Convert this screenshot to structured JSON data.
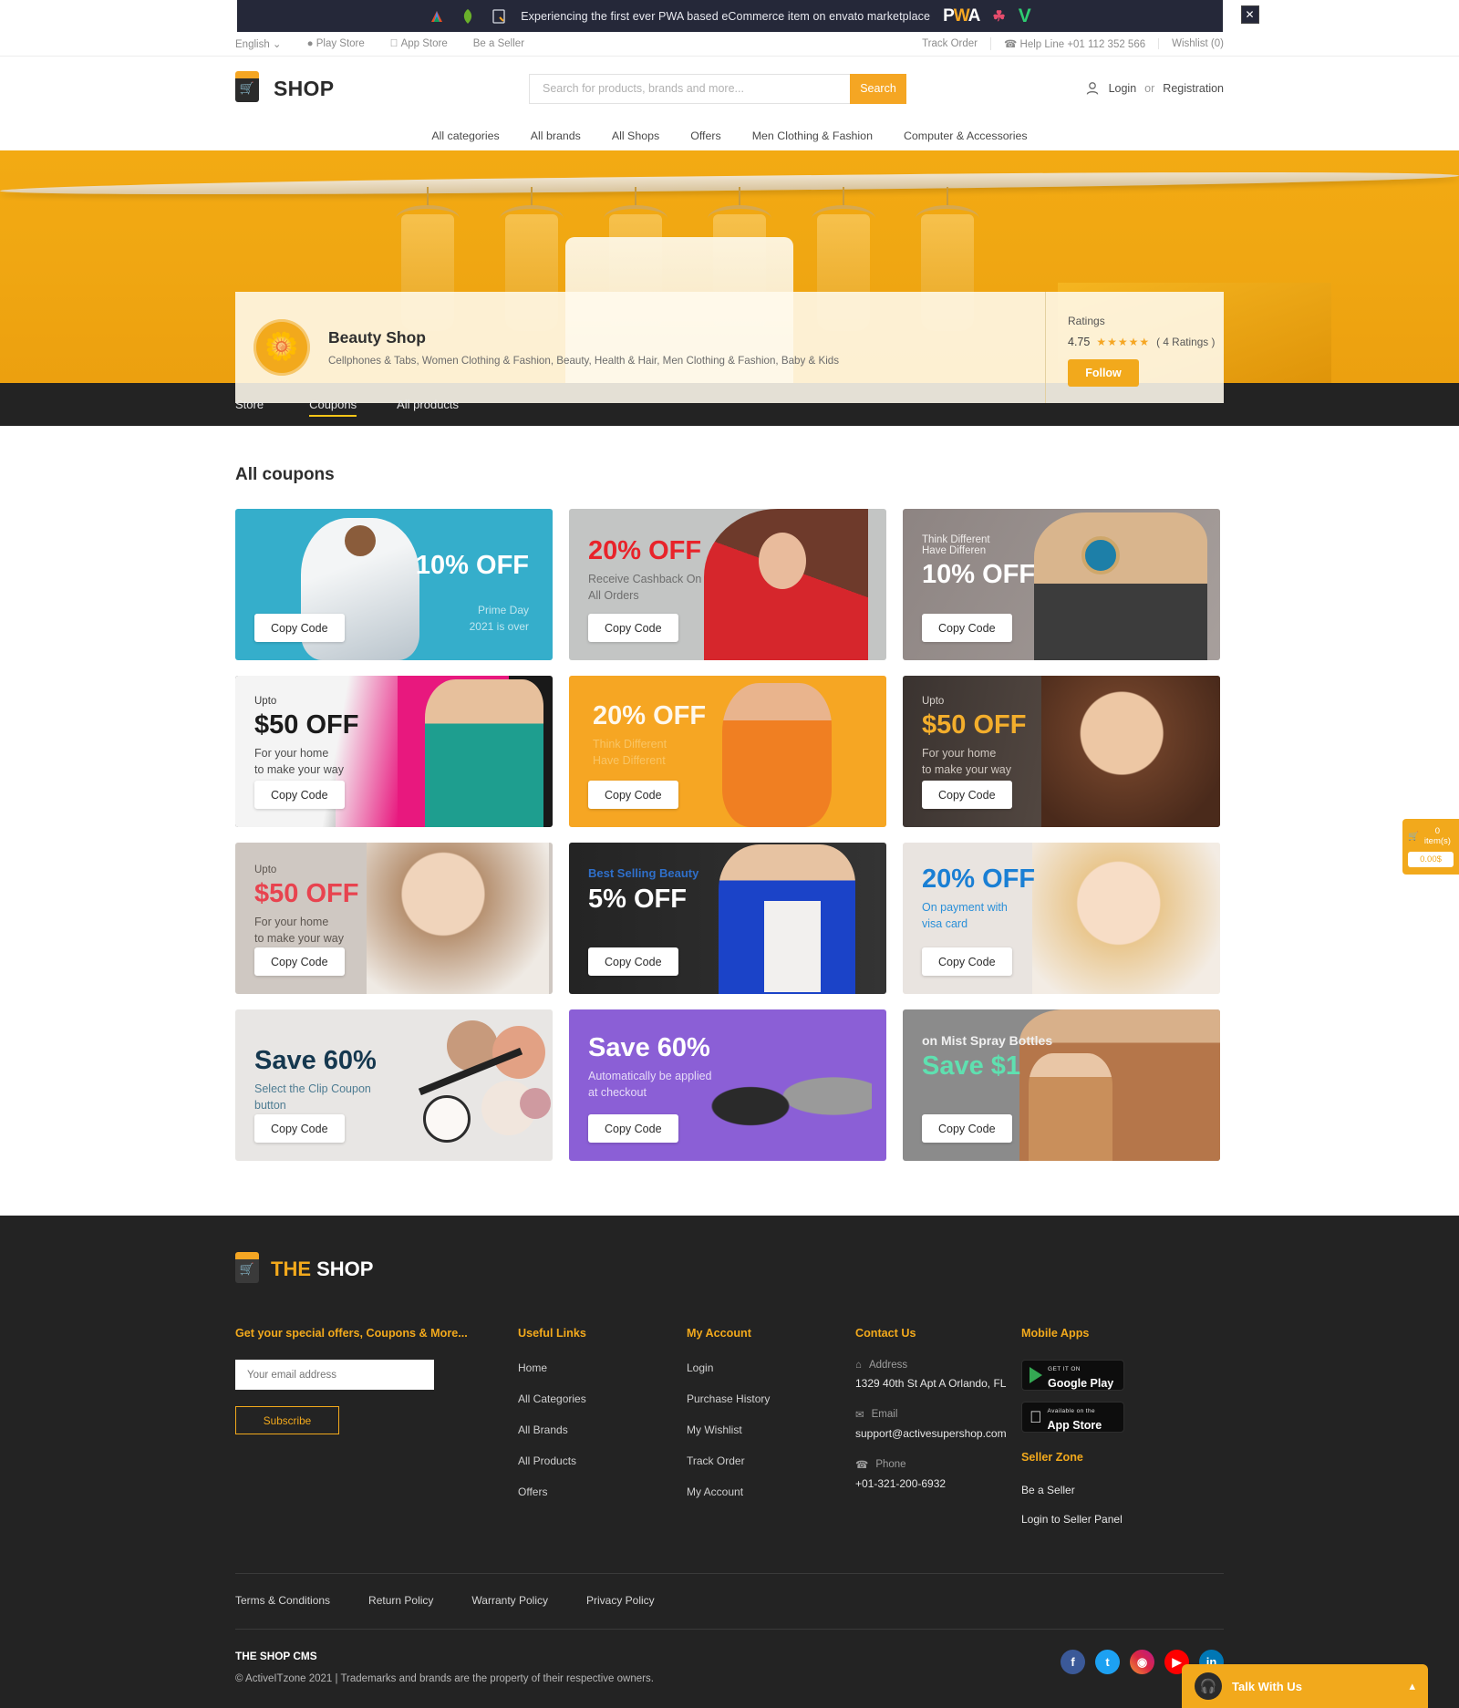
{
  "promo": {
    "text": "Experiencing the first ever PWA based eCommerce item on envato marketplace",
    "pwa_label": "PWA",
    "close_icon": "close-icon"
  },
  "topbar": {
    "language": "English",
    "play_store": "Play Store",
    "app_store": "App Store",
    "be_a_seller": "Be a Seller",
    "track_order": "Track Order",
    "help_line": "Help Line +01 112 352 566",
    "wishlist": "Wishlist (0)"
  },
  "header": {
    "brand": "SHOP",
    "search_placeholder": "Search for products, brands and more...",
    "search_value": "",
    "search_button": "Search",
    "login": "Login",
    "or": "or",
    "registration": "Registration"
  },
  "nav": {
    "items": [
      {
        "label": "All categories"
      },
      {
        "label": "All brands"
      },
      {
        "label": "All Shops"
      },
      {
        "label": "Offers"
      },
      {
        "label": "Men Clothing & Fashion"
      },
      {
        "label": "Computer & Accessories"
      }
    ]
  },
  "shop": {
    "name": "Beauty Shop",
    "categories": "Cellphones & Tabs, Women Clothing & Fashion, Beauty, Health & Hair, Men Clothing & Fashion, Baby & Kids",
    "ratings_label": "Ratings",
    "rating_value": "4.75",
    "stars": "★★★★",
    "half_star": "★",
    "ratings_count": "( 4 Ratings )",
    "follow_button": "Follow"
  },
  "tabs": [
    {
      "label": "Store",
      "active": false
    },
    {
      "label": "Coupons",
      "active": true
    },
    {
      "label": "All products",
      "active": false
    }
  ],
  "coupons_section": {
    "title": "All coupons",
    "copy_label": "Copy Code"
  },
  "coupons": [
    {
      "top": "",
      "big": "10% OFF",
      "small": "",
      "footnote": "Prime Day\n2021 is over"
    },
    {
      "top": "",
      "big": "20% OFF",
      "small": "Receive Cashback On\nAll Orders",
      "footnote": ""
    },
    {
      "top": "Think Different\nHave Differen",
      "big": "10% OFF",
      "small": "",
      "footnote": ""
    },
    {
      "top": "Upto",
      "big": "$50 OFF",
      "small": "For your home\nto make your way",
      "footnote": ""
    },
    {
      "top": "",
      "big": "20% OFF",
      "small": "Think Different\nHave Different",
      "footnote": ""
    },
    {
      "top": "Upto",
      "big": "$50 OFF",
      "small": "For your home\nto make your way",
      "footnote": ""
    },
    {
      "top": "Upto",
      "big": "$50 OFF",
      "small": "For your home\nto make your way",
      "footnote": ""
    },
    {
      "top": "Best Selling Beauty",
      "big": "5% OFF",
      "small": "",
      "footnote": ""
    },
    {
      "top": "",
      "big": "20% OFF",
      "small": "On payment with\nvisa card",
      "footnote": ""
    },
    {
      "top": "",
      "big": "Save 60%",
      "small": "Select the Clip Coupon\nbutton",
      "footnote": ""
    },
    {
      "top": "",
      "big": "Save 60%",
      "small": "Automatically be applied\nat checkout",
      "footnote": ""
    },
    {
      "top": "on Mist Spray Bottles",
      "big": "Save $1",
      "small": "",
      "footnote": ""
    }
  ],
  "cart_widget": {
    "items": "0 item(s)",
    "amount": "0.00$"
  },
  "footer": {
    "logo_the": "THE",
    "logo_shop": "SHOP",
    "newsletter_title": "Get your special offers, Coupons & More...",
    "email_placeholder": "Your email address",
    "email_value": "",
    "subscribe": "Subscribe",
    "useful_links_title": "Useful Links",
    "useful_links": [
      {
        "label": "Home"
      },
      {
        "label": "All Categories"
      },
      {
        "label": "All Brands"
      },
      {
        "label": "All Products"
      },
      {
        "label": "Offers"
      }
    ],
    "my_account_title": "My Account",
    "my_account": [
      {
        "label": "Login"
      },
      {
        "label": "Purchase History"
      },
      {
        "label": "My Wishlist"
      },
      {
        "label": "Track Order"
      },
      {
        "label": "My Account"
      }
    ],
    "contact_title": "Contact Us",
    "address_label": "Address",
    "address_value": "1329 40th St Apt A Orlando, FL",
    "email_label": "Email",
    "email_contact": "support@activesupershop.com",
    "phone_label": "Phone",
    "phone_value": "+01-321-200-6932",
    "mobile_apps_title": "Mobile Apps",
    "google_play_sub": "GET IT ON",
    "google_play_main": "Google Play",
    "app_store_sub": "Available on the",
    "app_store_main": "App Store",
    "seller_zone_title": "Seller Zone",
    "seller_links": [
      {
        "label": "Be a Seller"
      },
      {
        "label": "Login to Seller Panel"
      }
    ],
    "policies": [
      {
        "label": "Terms & Conditions"
      },
      {
        "label": "Return Policy"
      },
      {
        "label": "Warranty Policy"
      },
      {
        "label": "Privacy Policy"
      }
    ],
    "cms": "THE SHOP CMS",
    "copyright": "© ActiveITzone 2021 | Trademarks and brands are the property of their respective owners.",
    "socials": [
      {
        "name": "facebook",
        "glyph": "f"
      },
      {
        "name": "twitter",
        "glyph": "t"
      },
      {
        "name": "instagram",
        "glyph": "◉"
      },
      {
        "name": "youtube",
        "glyph": "▶"
      },
      {
        "name": "linkedin",
        "glyph": "in"
      }
    ]
  },
  "chat": {
    "label": "Talk With Us"
  },
  "colors": {
    "accent": "#f2a91c",
    "dark": "#232323",
    "promo_bg": "#252839"
  }
}
